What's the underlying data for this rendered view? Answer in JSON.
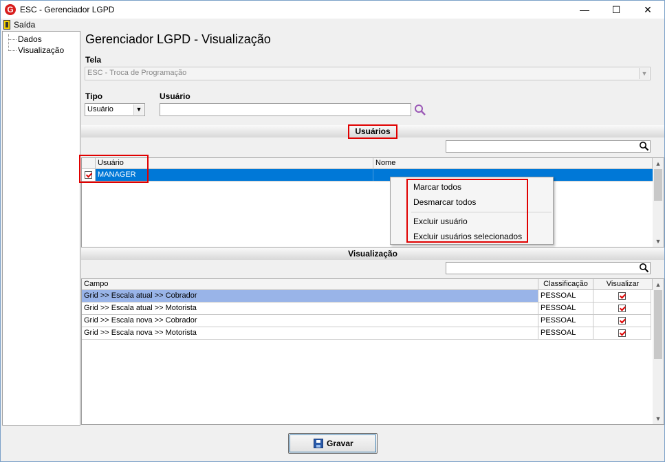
{
  "window": {
    "title": "ESC - Gerenciador LGPD"
  },
  "menu": {
    "exit_label": "Saída"
  },
  "tree": {
    "items": [
      "Dados",
      "Visualização"
    ]
  },
  "page": {
    "title": "Gerenciador LGPD - Visualização"
  },
  "tela": {
    "label": "Tela",
    "value": "ESC - Troca de Programação"
  },
  "tipo": {
    "label": "Tipo",
    "value": "Usuário"
  },
  "usuario": {
    "label": "Usuário",
    "value": ""
  },
  "users_section": {
    "title": "Usuários",
    "search_value": "",
    "columns": [
      "Usuário",
      "Nome"
    ],
    "rows": [
      {
        "checked": true,
        "usuario": "MANAGER",
        "nome": ""
      }
    ]
  },
  "context_menu": {
    "items": [
      "Marcar todos",
      "Desmarcar todos",
      "Excluir usuário",
      "Excluir usuários selecionados"
    ]
  },
  "view_section": {
    "title": "Visualização",
    "search_value": "",
    "columns": [
      "Campo",
      "Classificação",
      "Visualizar"
    ],
    "rows": [
      {
        "campo": "Grid >> Escala atual >> Cobrador",
        "classificacao": "PESSOAL",
        "visualizar": true
      },
      {
        "campo": "Grid >> Escala atual >> Motorista",
        "classificacao": "PESSOAL",
        "visualizar": true
      },
      {
        "campo": "Grid >> Escala nova >> Cobrador",
        "classificacao": "PESSOAL",
        "visualizar": true
      },
      {
        "campo": "Grid >> Escala nova >> Motorista",
        "classificacao": "PESSOAL",
        "visualizar": true
      }
    ]
  },
  "footer": {
    "save_label": "Gravar"
  },
  "colors": {
    "selected_row": "#0078d7",
    "highlight_row": "#99b4e8",
    "annotation": "#e00000",
    "search_icon": "#9b59b6"
  }
}
